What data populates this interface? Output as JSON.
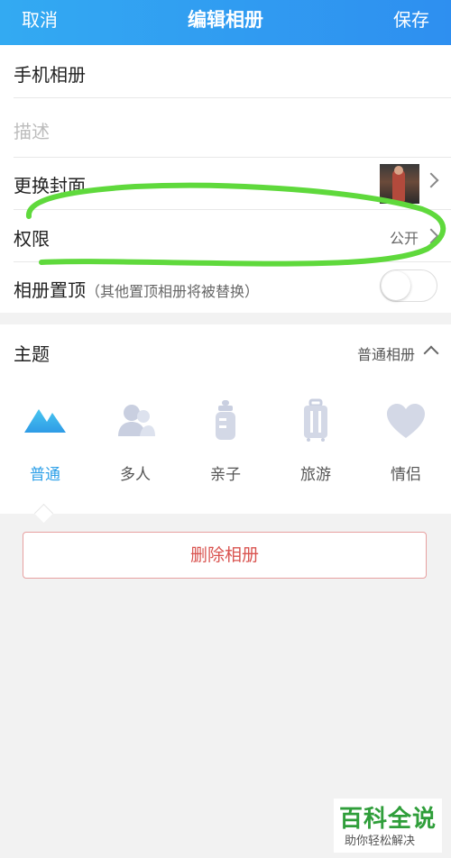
{
  "topbar": {
    "cancel": "取消",
    "title": "编辑相册",
    "save": "保存"
  },
  "form": {
    "album_name": "手机相册",
    "description_placeholder": "描述",
    "cover_label": "更换封面",
    "permission_label": "权限",
    "permission_value": "公开",
    "pin_label": "相册置顶",
    "pin_note": "（其他置顶相册将被替换）",
    "pin_enabled": false
  },
  "theme": {
    "label": "主题",
    "selected": "普通相册",
    "items": [
      {
        "label": "普通",
        "icon": "mountain-icon",
        "active": true
      },
      {
        "label": "多人",
        "icon": "people-icon",
        "active": false
      },
      {
        "label": "亲子",
        "icon": "baby-bottle-icon",
        "active": false
      },
      {
        "label": "旅游",
        "icon": "luggage-icon",
        "active": false
      },
      {
        "label": "情侣",
        "icon": "heart-icon",
        "active": false
      }
    ]
  },
  "delete_label": "删除相册",
  "watermark": {
    "title": "百科全说",
    "subtitle": "助你轻松解决"
  },
  "colors": {
    "accent": "#2ea0e8",
    "danger": "#d9534f",
    "annotation": "#5fd93c"
  }
}
